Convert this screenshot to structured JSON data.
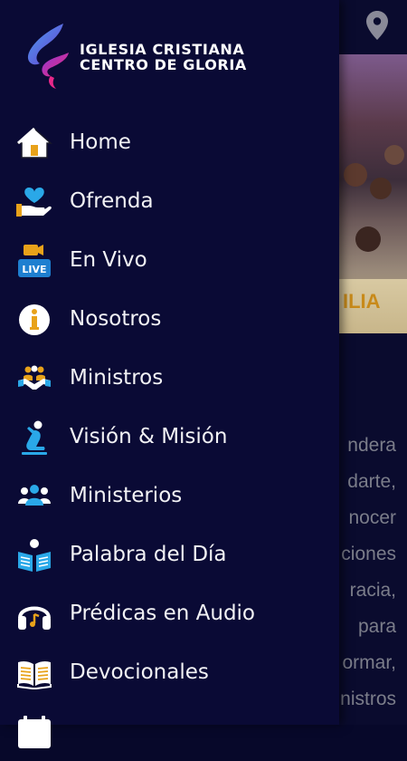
{
  "brand": {
    "line1": "IGLESIA CRISTIANA",
    "line2": "CENTRO DE GLORIA",
    "colors": {
      "logo_blue": "#3a78e0",
      "logo_pink": "#e8288a",
      "logo_purple": "#7a3ad0"
    }
  },
  "menu": {
    "items": [
      {
        "label": "Home",
        "icon": "home-icon"
      },
      {
        "label": "Ofrenda",
        "icon": "giving-hand-heart-icon"
      },
      {
        "label": "En Vivo",
        "icon": "live-camera-icon"
      },
      {
        "label": "Nosotros",
        "icon": "info-icon"
      },
      {
        "label": "Ministros",
        "icon": "handshake-group-icon"
      },
      {
        "label": "Visión & Misión",
        "icon": "praying-person-icon"
      },
      {
        "label": "Ministerios",
        "icon": "people-group-icon"
      },
      {
        "label": "Palabra del Día",
        "icon": "reading-book-icon"
      },
      {
        "label": "Prédicas en Audio",
        "icon": "headphones-icon"
      },
      {
        "label": "Devocionales",
        "icon": "open-bible-icon"
      },
      {
        "label": "",
        "icon": "calendar-icon"
      }
    ]
  },
  "background": {
    "banner_text": "ILIA",
    "text_lines": [
      "ndera",
      "darte,",
      "nocer",
      "ciones",
      "racia,",
      "para",
      "ormar,",
      "nistros"
    ],
    "location_icon": "location-pin-icon"
  },
  "colors": {
    "drawer_bg": "#0a0a35",
    "accent_blue": "#2aa8e8",
    "live_badge": "#1e7fd0",
    "gold": "#e8a21a"
  }
}
